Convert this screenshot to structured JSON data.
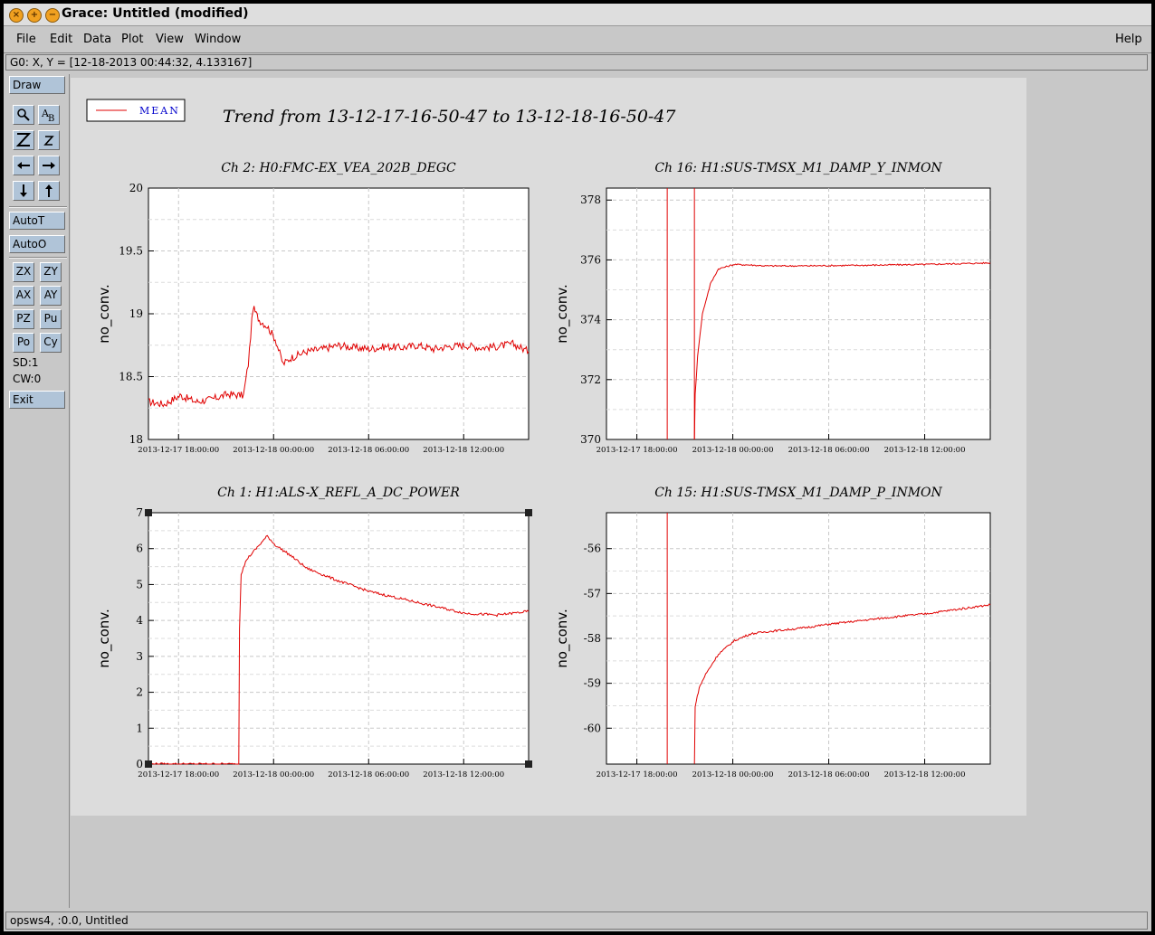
{
  "window": {
    "title": "Grace: Untitled (modified)"
  },
  "menubar": {
    "items": [
      {
        "label": "File",
        "id": "file"
      },
      {
        "label": "Edit",
        "id": "edit"
      },
      {
        "label": "Data",
        "id": "data"
      },
      {
        "label": "Plot",
        "id": "plot"
      },
      {
        "label": "View",
        "id": "view"
      },
      {
        "label": "Window",
        "id": "window"
      }
    ],
    "help_label": "Help"
  },
  "locator": {
    "text": "G0: X, Y = [12-18-2013 00:44:32, 4.133167]"
  },
  "toolbar": {
    "draw": "Draw",
    "autot": "AutoT",
    "autoo": "AutoO",
    "zx": "ZX",
    "zy": "ZY",
    "ax": "AX",
    "ay": "AY",
    "pz": "PZ",
    "pu": "Pu",
    "po": "Po",
    "cy": "Cy",
    "sd": "SD:1",
    "cw": "CW:0",
    "exit": "Exit",
    "icons": [
      "zoom-icon",
      "text-icon",
      "zoom-in-icon",
      "zoom-out-icon",
      "arrow-left-icon",
      "arrow-right-icon",
      "arrow-down-icon",
      "arrow-up-icon"
    ]
  },
  "status": {
    "text": "opsws4, :0.0, Untitled"
  },
  "plot": {
    "title": "Trend from 13-12-17-16-50-47 to 13-12-18-16-50-47",
    "legend": "MEAN",
    "line_color": "#e00000",
    "y_label": "no_conv."
  },
  "chart_data": [
    {
      "type": "line",
      "title": "Ch 2: H0:FMC-EX_VEA_202B_DEGC",
      "ylabel": "no_conv.",
      "ylim": [
        18,
        20
      ],
      "yticks": [
        "20",
        "19.5",
        "19",
        "18.5",
        "18"
      ],
      "xticks": [
        "2013-12-17 18:00:00",
        "2013-12-18 00:00:00",
        "2013-12-18 06:00:00",
        "2013-12-18 12:00:00"
      ],
      "x_hours": [
        0,
        1,
        2,
        3,
        4,
        5,
        6,
        6.3,
        6.6,
        7,
        7.5,
        8,
        8.5,
        9,
        10,
        11,
        12,
        13,
        14,
        15,
        16,
        17,
        18,
        19,
        20,
        21,
        22,
        23,
        24
      ],
      "values": [
        18.3,
        18.28,
        18.35,
        18.3,
        18.32,
        18.36,
        18.35,
        18.6,
        19.05,
        18.95,
        18.9,
        18.8,
        18.6,
        18.65,
        18.7,
        18.72,
        18.75,
        18.73,
        18.72,
        18.74,
        18.73,
        18.75,
        18.72,
        18.74,
        18.75,
        18.73,
        18.74,
        18.76,
        18.7
      ]
    },
    {
      "type": "line",
      "title": "Ch 16: H1:SUS-TMSX_M1_DAMP_Y_INMON",
      "ylabel": "no_conv.",
      "ylim": [
        370,
        378.4
      ],
      "yticks": [
        "378",
        "376",
        "374",
        "372",
        "370"
      ],
      "xticks": [
        "2013-12-17 18:00:00",
        "2013-12-18 00:00:00",
        "2013-12-18 06:00:00",
        "2013-12-18 12:00:00"
      ],
      "x_hours": [
        5.5,
        5.55,
        5.7,
        6,
        6.5,
        7,
        8,
        9,
        10,
        12,
        16,
        20,
        24
      ],
      "values": [
        370,
        371.5,
        372.8,
        374.2,
        375.2,
        375.7,
        375.85,
        375.83,
        375.8,
        375.8,
        375.82,
        375.85,
        375.9
      ]
    },
    {
      "type": "line",
      "title": "Ch 1: H1:ALS-X_REFL_A_DC_POWER",
      "ylabel": "no_conv.",
      "ylim": [
        0,
        7
      ],
      "yticks": [
        "7",
        "6",
        "5",
        "4",
        "3",
        "2",
        "1",
        "0"
      ],
      "xticks": [
        "2013-12-17 18:00:00",
        "2013-12-18 00:00:00",
        "2013-12-18 06:00:00",
        "2013-12-18 12:00:00"
      ],
      "x_hours": [
        0,
        5.7,
        5.75,
        5.85,
        6.2,
        6.8,
        7.5,
        8,
        9,
        10,
        12,
        14,
        16,
        18,
        20,
        22,
        23,
        24
      ],
      "values": [
        0,
        0,
        3.8,
        5.3,
        5.7,
        6.0,
        6.35,
        6.1,
        5.8,
        5.45,
        5.1,
        4.8,
        4.6,
        4.4,
        4.2,
        4.15,
        4.2,
        4.25
      ]
    },
    {
      "type": "line",
      "title": "Ch 15: H1:SUS-TMSX_M1_DAMP_P_INMON",
      "ylabel": "no_conv.",
      "ylim": [
        -60.8,
        -55.2
      ],
      "yticks": [
        "-56",
        "-57",
        "-58",
        "-59",
        "-60"
      ],
      "xticks": [
        "2013-12-17 18:00:00",
        "2013-12-18 00:00:00",
        "2013-12-18 06:00:00",
        "2013-12-18 12:00:00"
      ],
      "x_hours": [
        5.5,
        5.55,
        5.8,
        6.2,
        7,
        8,
        9,
        10,
        12,
        14,
        16,
        18,
        20,
        22,
        24
      ],
      "values": [
        -60.8,
        -59.5,
        -59.1,
        -58.8,
        -58.35,
        -58.05,
        -57.9,
        -57.85,
        -57.78,
        -57.68,
        -57.6,
        -57.52,
        -57.45,
        -57.35,
        -57.25
      ]
    }
  ]
}
